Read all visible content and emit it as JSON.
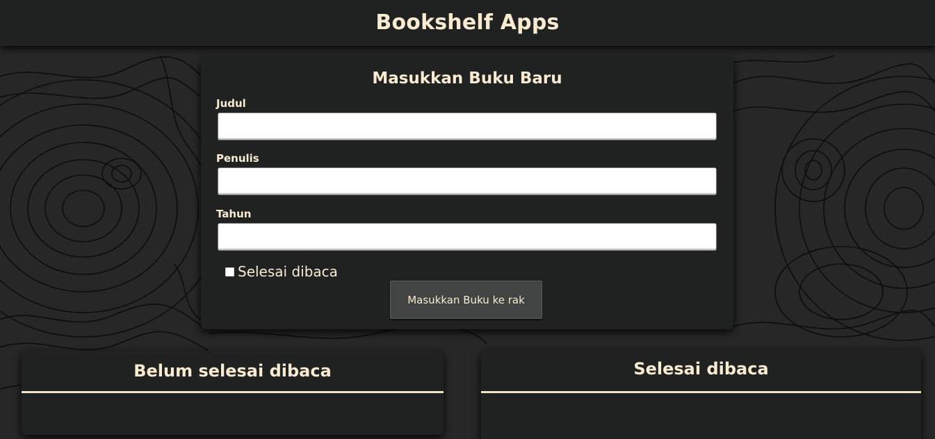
{
  "app": {
    "title": "Bookshelf Apps"
  },
  "input_form": {
    "title": "Masukkan Buku Baru",
    "fields": [
      {
        "label": "Judul",
        "value": "",
        "placeholder": ""
      },
      {
        "label": "Penulis",
        "value": "",
        "placeholder": ""
      },
      {
        "label": "Tahun",
        "value": "",
        "placeholder": ""
      }
    ],
    "checkbox": {
      "label": "Selesai dibaca",
      "checked": false
    },
    "submit_label": "Masukkan Buku ke rak"
  },
  "shelves": {
    "incomplete": {
      "title": "Belum selesai dibaca"
    },
    "complete": {
      "title": "Selesai dibaca"
    }
  },
  "colors": {
    "background": "#272727",
    "panel": "#202221",
    "text": "#f8ebd2",
    "button": "#424343",
    "divider": "#f1e3c6"
  }
}
